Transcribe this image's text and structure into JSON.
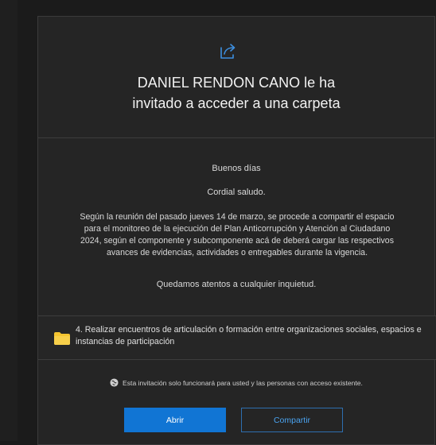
{
  "invitation": {
    "title_line1": "DANIEL RENDON CANO le ha",
    "title_line2": "invitado a acceder a una carpeta"
  },
  "message": {
    "greeting": "Buenos días",
    "salutation": "Cordial saludo.",
    "body": "Según la reunión del pasado jueves 14 de marzo, se procede a compartir el espacio para el monitoreo de la ejecución del Plan Anticorrupción y Atención al Ciudadano 2024, según el componente y subcomponente acá de deberá cargar las respectivos avances de evidencias, actividades o entregables durante la vigencia.",
    "closing": "Quedamos atentos a cualquier inquietud."
  },
  "folder": {
    "name": "4. Realizar encuentros de articulación o formación entre organizaciones sociales, espacios e instancias de participación",
    "icon": "folder-icon",
    "color": "#f4c430"
  },
  "notice": {
    "text": "Esta invitación solo funcionará para usted y las personas con acceso existente.",
    "icon": "globe-icon"
  },
  "actions": {
    "open_label": "Abrir",
    "share_label": "Compartir"
  },
  "colors": {
    "accent": "#1175d4",
    "share_icon": "#3d8fe0",
    "background": "#252525"
  }
}
